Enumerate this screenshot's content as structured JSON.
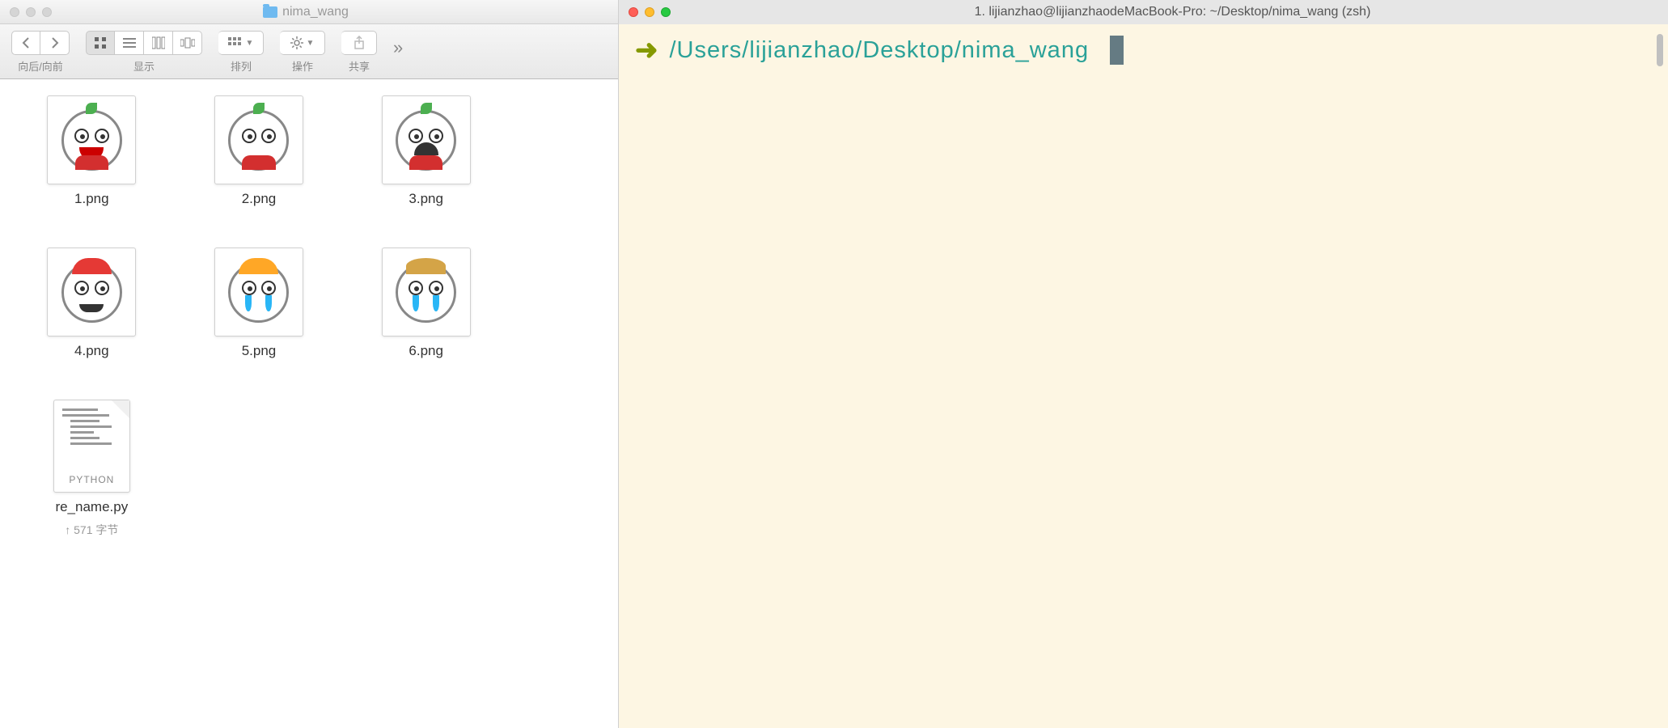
{
  "finder": {
    "title": "nima_wang",
    "toolbar": {
      "back_forward_label": "向后/向前",
      "display_label": "显示",
      "arrange_label": "排列",
      "action_label": "操作",
      "share_label": "共享"
    },
    "files": [
      {
        "name": "1.png",
        "type": "image"
      },
      {
        "name": "2.png",
        "type": "image"
      },
      {
        "name": "3.png",
        "type": "image"
      },
      {
        "name": "4.png",
        "type": "image"
      },
      {
        "name": "5.png",
        "type": "image"
      },
      {
        "name": "6.png",
        "type": "image"
      },
      {
        "name": "re_name.py",
        "type": "python",
        "meta": "↑ 571 字节"
      }
    ],
    "python_badge": "PYTHON"
  },
  "terminal": {
    "title": "1. lijianzhao@lijianzhaodeMacBook-Pro: ~/Desktop/nima_wang (zsh)",
    "prompt_arrow": "➜",
    "prompt_path": "/Users/lijianzhao/Desktop/nima_wang"
  }
}
